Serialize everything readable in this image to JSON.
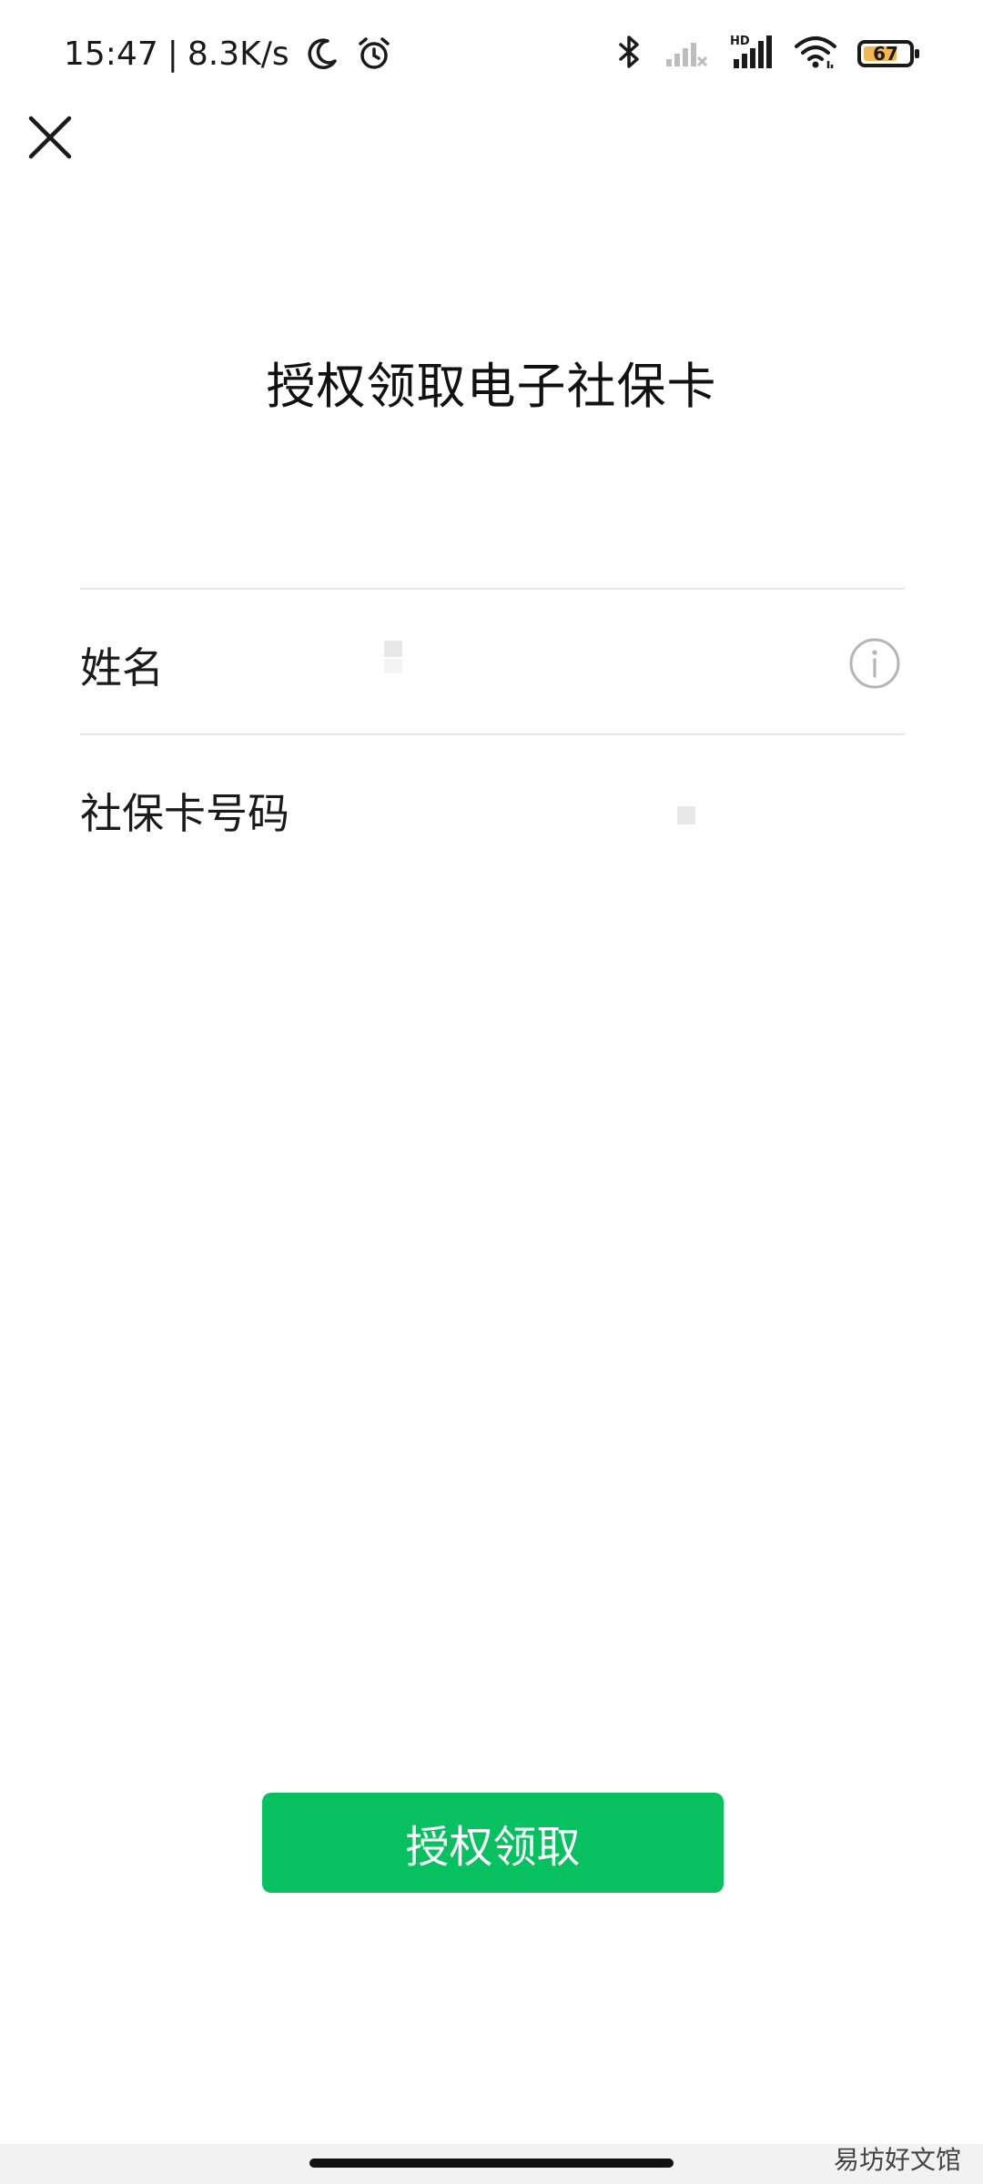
{
  "status_bar": {
    "time": "15:47",
    "separator": "|",
    "net_speed": "8.3K/s",
    "battery_level": "67",
    "icons": [
      "moon-icon",
      "alarm-icon",
      "bluetooth-icon",
      "signal-weak-icon",
      "hd-signal-icon",
      "wifi-icon",
      "battery-icon"
    ]
  },
  "header": {
    "close_icon": "close-icon"
  },
  "page": {
    "title": "授权领取电子社保卡"
  },
  "form": {
    "name_label": "姓名",
    "card_number_label": "社保卡号码",
    "info_icon": "info-icon"
  },
  "actions": {
    "authorize_label": "授权领取"
  },
  "footer": {
    "watermark": "易坊好文馆"
  },
  "colors": {
    "accent": "#07c160",
    "divider": "#e6e6e6",
    "battery_fill": "#f2b84b"
  }
}
